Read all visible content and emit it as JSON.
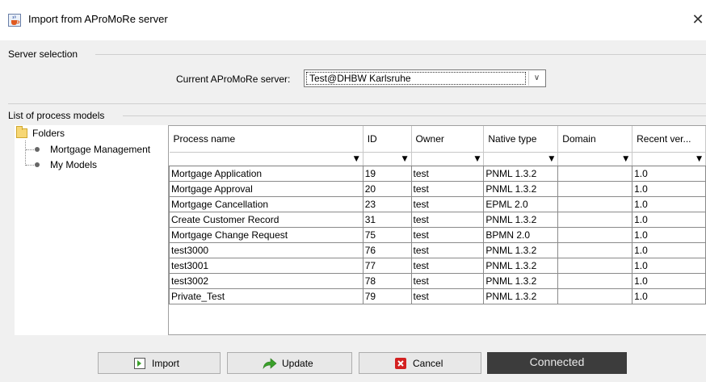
{
  "window": {
    "title": "Import from AProMoRe server",
    "close_glyph": "✕"
  },
  "server_selection": {
    "legend": "Server selection",
    "label": "Current AProMoRe server:",
    "value": "Test@DHBW Karlsruhe"
  },
  "models": {
    "legend": "List of process models",
    "tree": {
      "root": "Folders",
      "children": [
        "Mortgage Management",
        "My Models"
      ]
    },
    "table": {
      "columns": [
        "Process name",
        "ID",
        "Owner",
        "Native type",
        "Domain",
        "Recent ver..."
      ],
      "rows": [
        [
          "Mortgage Application",
          "19",
          "test",
          "PNML 1.3.2",
          "",
          "1.0"
        ],
        [
          "Mortgage Approval",
          "20",
          "test",
          "PNML 1.3.2",
          "",
          "1.0"
        ],
        [
          "Mortgage Cancellation",
          "23",
          "test",
          "EPML 2.0",
          "",
          "1.0"
        ],
        [
          "Create Customer Record",
          "31",
          "test",
          "PNML 1.3.2",
          "",
          "1.0"
        ],
        [
          "Mortgage Change Request",
          "75",
          "test",
          "BPMN 2.0",
          "",
          "1.0"
        ],
        [
          "test3000",
          "76",
          "test",
          "PNML 1.3.2",
          "",
          "1.0"
        ],
        [
          "test3001",
          "77",
          "test",
          "PNML 1.3.2",
          "",
          "1.0"
        ],
        [
          "test3002",
          "78",
          "test",
          "PNML 1.3.2",
          "",
          "1.0"
        ],
        [
          "Private_Test",
          "79",
          "test",
          "PNML 1.3.2",
          "",
          "1.0"
        ]
      ]
    }
  },
  "buttons": {
    "import": "Import",
    "update": "Update",
    "cancel": "Cancel"
  },
  "status": "Connected",
  "icons": {
    "app": "java-cup-icon",
    "folder": "folder-icon",
    "import": "import-arrow-icon",
    "update": "green-arrow-icon",
    "cancel": "red-x-icon"
  },
  "colors": {
    "status_bg": "#3c3c3c",
    "cancel_red": "#d32020",
    "update_green": "#3aa02a"
  }
}
